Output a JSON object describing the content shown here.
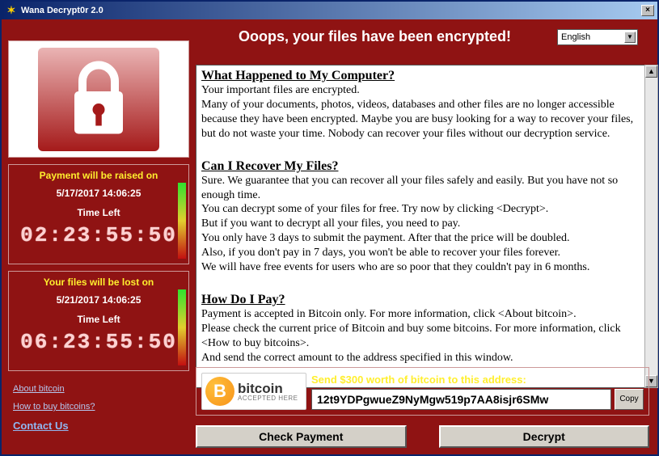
{
  "window": {
    "title": "Wana Decrypt0r 2.0"
  },
  "header": {
    "ooops": "Ooops, your files have been encrypted!",
    "language": "English"
  },
  "countdown1": {
    "title": "Payment will be raised on",
    "date": "5/17/2017 14:06:25",
    "time_left_label": "Time Left",
    "digits": "02:23:55:50"
  },
  "countdown2": {
    "title": "Your files will be lost on",
    "date": "5/21/2017 14:06:25",
    "time_left_label": "Time Left",
    "digits": "06:23:55:50"
  },
  "links": {
    "about_bitcoin": "About bitcoin",
    "how_to_buy": "How to buy bitcoins?",
    "contact": "Contact Us"
  },
  "body": {
    "h1": "What Happened to My Computer?",
    "p1": "Your important files are encrypted.",
    "p2": "Many of your documents, photos, videos, databases and other files are no longer accessible because they have been encrypted. Maybe you are busy looking for a way to recover your files, but do not waste your time. Nobody can recover your files without our decryption service.",
    "h2": "Can I Recover My Files?",
    "p3": "Sure. We guarantee that you can recover all your files safely and easily. But you have not so enough time.",
    "p4": "You can decrypt some of your files for free. Try now by clicking <Decrypt>.",
    "p5": "But if you want to decrypt all your files, you need to pay.",
    "p6": "You only have 3 days to submit the payment. After that the price will be doubled.",
    "p7": "Also, if you don't pay in 7 days, you won't be able to recover your files forever.",
    "p8": "We will have free events for users who are so poor that they couldn't pay in 6 months.",
    "h3": "How Do I Pay?",
    "p9": "Payment is accepted in Bitcoin only. For more information, click <About bitcoin>.",
    "p10": "Please check the current price of Bitcoin and buy some bitcoins. For more information, click <How to buy bitcoins>.",
    "p11": "And send the correct amount to the address specified in this window."
  },
  "payment": {
    "bitcoin_word": "bitcoin",
    "accepted": "ACCEPTED HERE",
    "send_label": "Send $300 worth of bitcoin to this address:",
    "address": "12t9YDPgwueZ9NyMgw519p7AA8isjr6SMw",
    "copy": "Copy"
  },
  "buttons": {
    "check": "Check Payment",
    "decrypt": "Decrypt"
  }
}
